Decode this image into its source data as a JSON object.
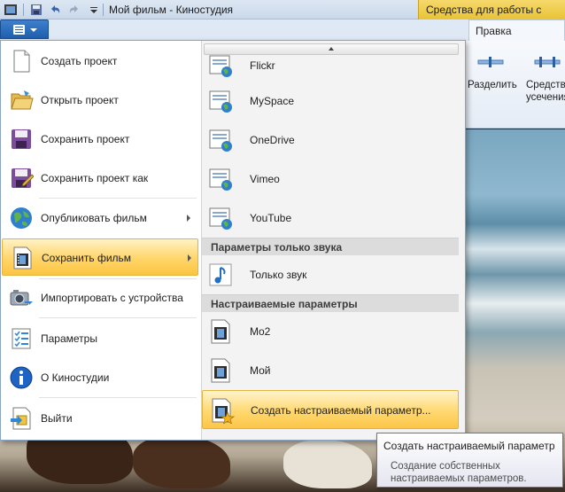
{
  "titlebar": {
    "window_title": "Мой фильм - Киностудия",
    "contextual_tab_title": "Средства для работы с видео"
  },
  "ribbon": {
    "tab_edit": "Правка",
    "split_label": "Разделить",
    "trim_label_line1": "Средство",
    "trim_label_line2": "усечения"
  },
  "menu": {
    "items": [
      {
        "label": "Создать проект",
        "icon": "new-project-icon"
      },
      {
        "label": "Открыть проект",
        "icon": "open-folder-icon"
      },
      {
        "label": "Сохранить проект",
        "icon": "save-disk-icon"
      },
      {
        "label": "Сохранить проект как",
        "icon": "save-as-icon"
      },
      {
        "label": "Опубликовать фильм",
        "icon": "globe-icon"
      },
      {
        "label": "Сохранить фильм",
        "icon": "film-icon"
      },
      {
        "label": "Импортировать с устройства",
        "icon": "camera-icon"
      },
      {
        "label": "Параметры",
        "icon": "options-list-icon"
      },
      {
        "label": "О Киностудии",
        "icon": "info-icon"
      },
      {
        "label": "Выйти",
        "icon": "exit-icon"
      }
    ]
  },
  "submenu": {
    "services": [
      {
        "label": "Flickr"
      },
      {
        "label": "MySpace"
      },
      {
        "label": "OneDrive"
      },
      {
        "label": "Vimeo"
      },
      {
        "label": "YouTube"
      }
    ],
    "audio_header": "Параметры только звука",
    "audio_only": "Только звук",
    "custom_header": "Настраиваемые параметры",
    "custom_items": [
      {
        "label": "Mo2"
      },
      {
        "label": "Мой"
      }
    ],
    "create_custom": "Создать настраиваемый параметр..."
  },
  "tooltip": {
    "title": "Создать настраиваемый параметр",
    "body": "Создание собственных настраиваемых параметров."
  },
  "colors": {
    "highlight": "#ffd568",
    "file_button": "#2b6bbd",
    "context_tab": "#f0cc45"
  }
}
